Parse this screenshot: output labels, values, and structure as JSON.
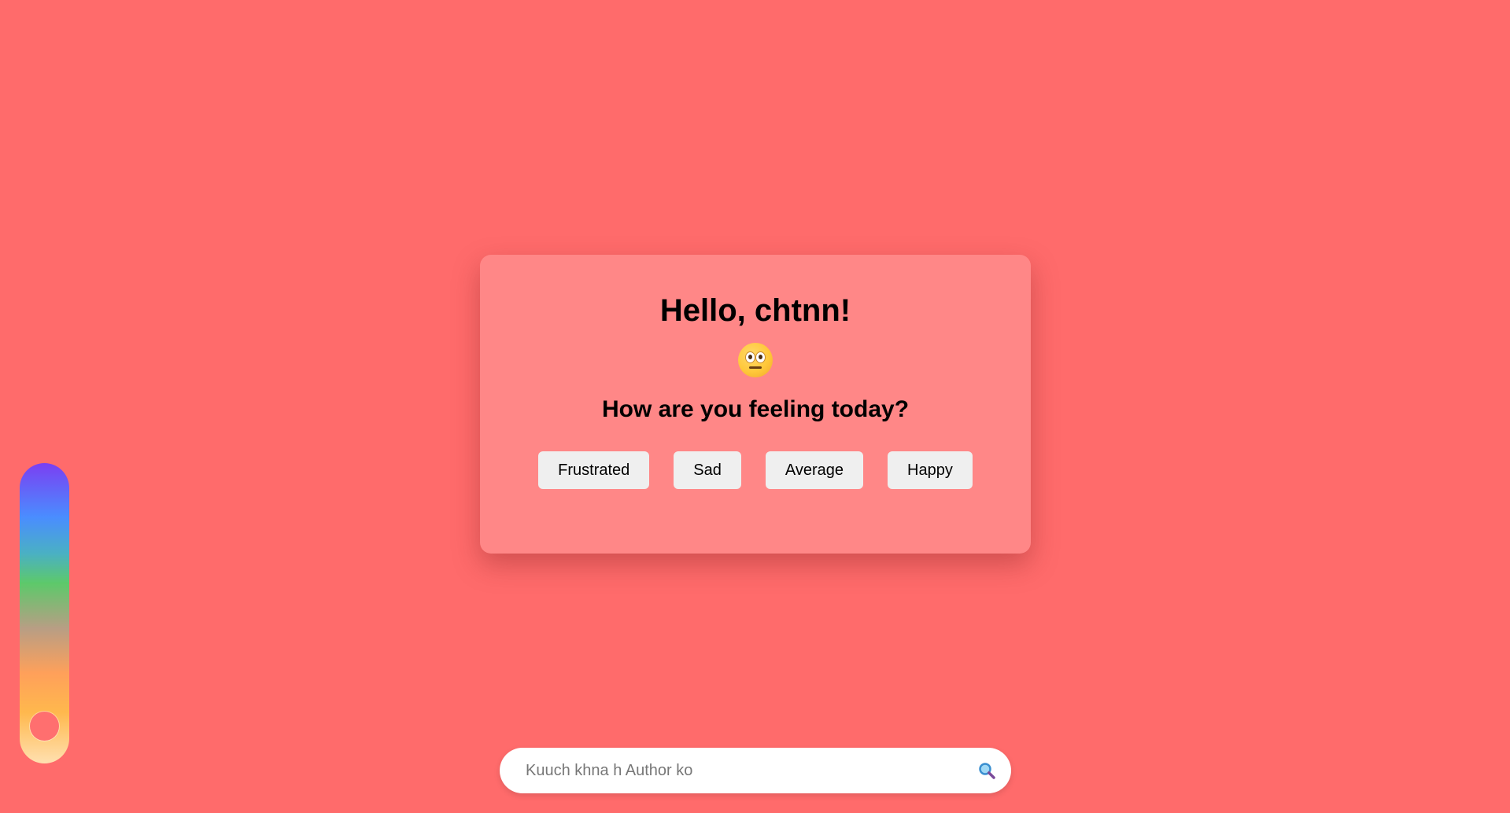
{
  "card": {
    "greeting": "Hello, chtnn!",
    "emoji": "neutral-face-emoji",
    "question": "How are you feeling today?",
    "moods": [
      "Frustrated",
      "Sad",
      "Average",
      "Happy"
    ]
  },
  "mood_slider": {
    "level": 0.05,
    "handle_color": "#ff6f6f"
  },
  "search": {
    "placeholder": "Kuuch khna h Author ko",
    "value": "",
    "icon": "search-icon"
  },
  "colors": {
    "background": "#ff6b6b",
    "card": "#ff8787",
    "button": "#efefef"
  }
}
